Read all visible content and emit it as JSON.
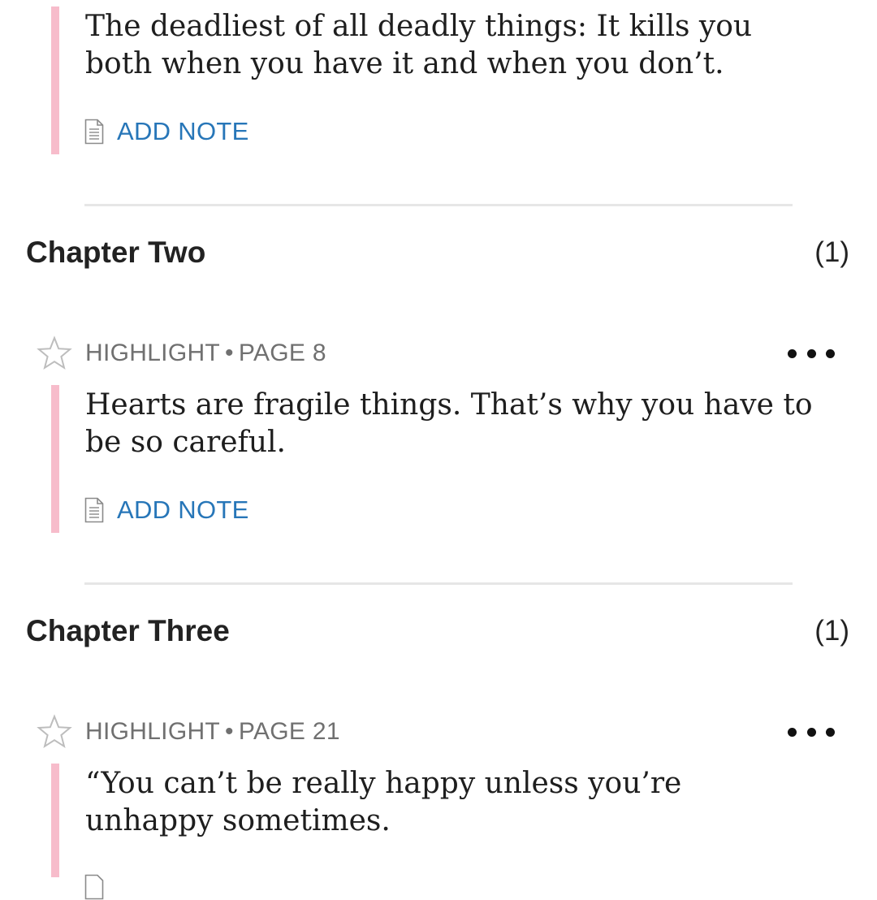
{
  "highlights": [
    {
      "text": "The deadliest of all deadly things: It kills you both when you have it and when you don’t.",
      "add_note_label": "ADD NOTE"
    },
    {
      "type_label": "HIGHLIGHT",
      "page_label": "PAGE 8",
      "text": "Hearts are fragile things. That’s why you have to be so careful.",
      "add_note_label": "ADD NOTE"
    },
    {
      "type_label": "HIGHLIGHT",
      "page_label": "PAGE 21",
      "text": "“You can’t be really happy unless you’re unhappy sometimes."
    }
  ],
  "chapters": [
    {
      "title": "Chapter Two",
      "count": "(1)"
    },
    {
      "title": "Chapter Three",
      "count": "(1)"
    }
  ],
  "colors": {
    "highlight_bar": "#f7bccb",
    "link": "#2776b8",
    "meta_text": "#707070"
  },
  "icons": {
    "note": "note-icon",
    "star": "star-outline-icon",
    "more": "more-options-icon"
  }
}
